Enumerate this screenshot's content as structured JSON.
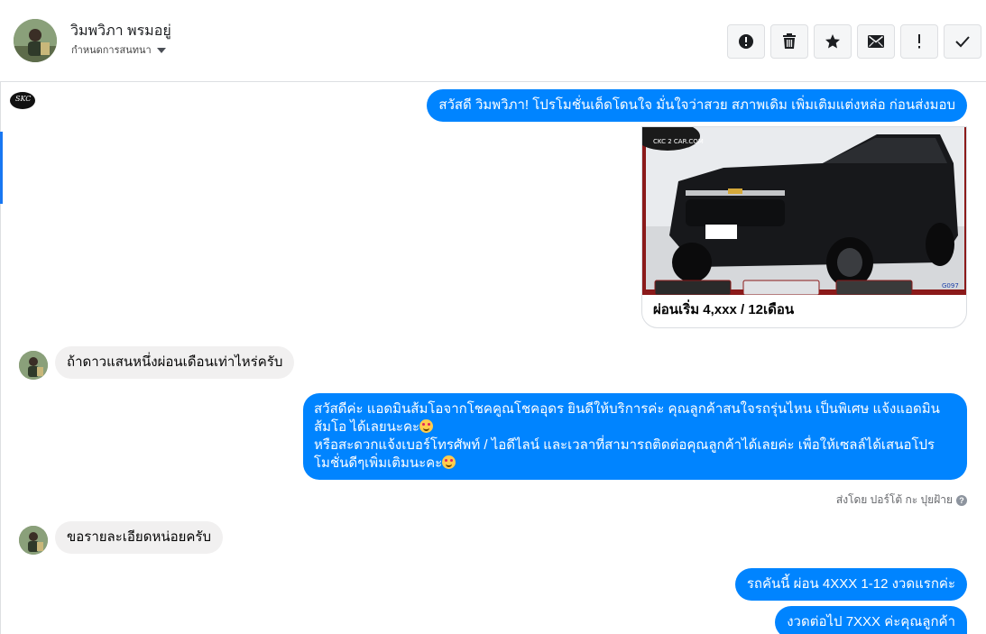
{
  "header": {
    "contact_name": "วิมพวิภา พรมอยู่",
    "conversation_settings": "กำหนดการสนทนา",
    "toolbar": [
      {
        "icon": "alert-circle-icon",
        "name": "spam-button"
      },
      {
        "icon": "trash-icon",
        "name": "delete-button"
      },
      {
        "icon": "star-icon",
        "name": "star-button"
      },
      {
        "icon": "envelope-icon",
        "name": "mark-unread-button"
      },
      {
        "icon": "exclamation-icon",
        "name": "follow-up-button"
      },
      {
        "icon": "checkmark-icon",
        "name": "mark-done-button"
      }
    ]
  },
  "page_logo_text": "SKC",
  "messages": {
    "m1": "สวัสดี วิมพวิภา! โปรโมชั่นเด็ดโดนใจ มั่นใจว่าสวย สภาพเดิม เพิ่มเติมแต่งหล่อ ก่อนส่งมอบ",
    "card_caption": "ผ่อนเริ่ม 4,xxx / 12เดือน",
    "card_watermark": "CKC 2 CAR.COM",
    "card_code": "G097",
    "m2": "ถ้าดาวแสนหนึ่งผ่อนเดือนเท่าไหร่ครับ",
    "m3_line1": "สวัสดีค่ะ แอดมินส้มโอจากโชคคูณโชคอุดร ยินดีให้บริการค่ะ   คุณลูกค้าสนใจรถรุ่นไหน เป็นพิเศษ แจ้งแอดมิน",
    "m3_line2": "ส้มโอ ได้เลยนะคะ",
    "m3_line3": "หรือสะดวกแจ้งเบอร์โทรศัพท์ / ไอดีไลน์ และเวลาที่สามารถติดต่อคุณลูกค้าได้เลยค่ะ เพื่อให้เซลล์ได้เสนอโปร",
    "m3_line4": "โมชั่นดีๆเพิ่มเติมนะคะ",
    "sent_by": "ส่งโดย ปอร์โต้ กะ ปุยฝ้าย",
    "m4": "ขอรายละเอียดหน่อยครับ",
    "m5": "รถคันนี้ ผ่อน 4XXX  1-12 งวดแรกค่ะ",
    "m6": "งวดต่อไป 7XXX ค่ะคุณลูกค้า"
  },
  "colors": {
    "outgoing_bubble": "#0084ff",
    "incoming_bubble": "#f1f0f0",
    "accent": "#1877f2"
  }
}
